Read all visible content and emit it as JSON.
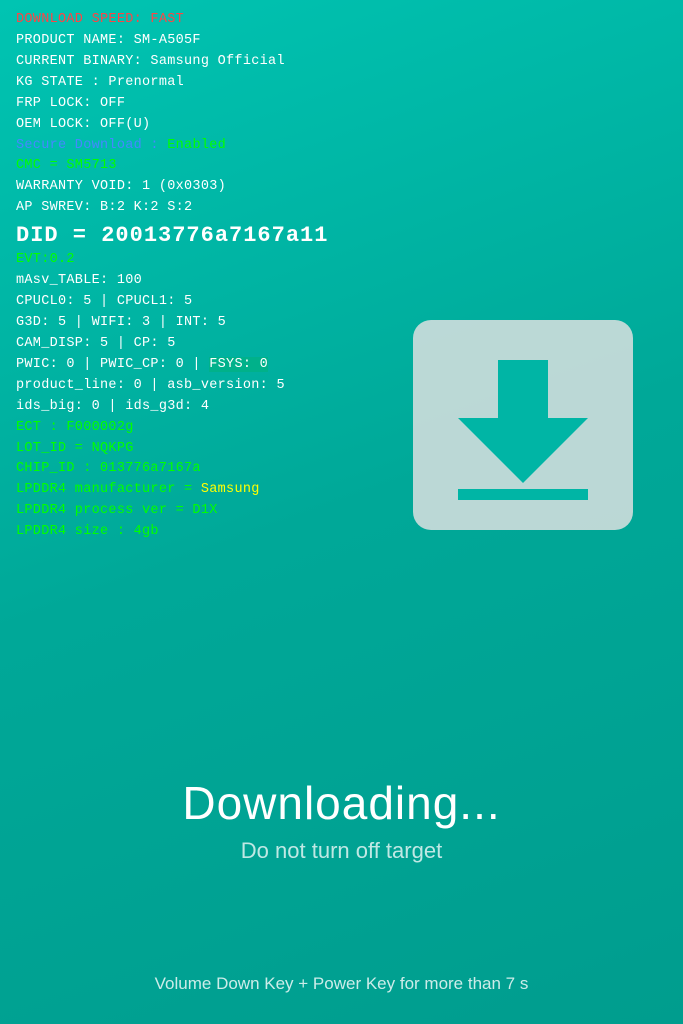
{
  "header": {
    "download_speed": "DOWNLOAD SPEED: FAST",
    "product_name": "PRODUCT NAME: SM-A505F",
    "current_binary": "CURRENT BINARY: Samsung Official",
    "kg_state": "KG STATE : Prenormal",
    "frp_lock": "FRP LOCK: OFF",
    "oem_lock": "OEM LOCK: OFF(U)",
    "secure_download_label": "Secure Download : ",
    "secure_download_value": "Enabled",
    "cmc": "CMC = SM5713",
    "warranty": "WARRANTY VOID: 1 (0x0303)",
    "ap_swrev": "AP SWREV: B:2 K:2 S:2",
    "did": "DID = 20013776a7167a11",
    "evt": "EVT:0.2",
    "masv": "mAsv_TABLE: 100",
    "cpucl0": "CPUCL0: 5 | CPUCL1: 5",
    "g3d": "G3D: 5 | WIFI: 3 | INT: 5",
    "cam_disp": "CAM_DISP: 5 | CP: 5",
    "pwic": "PWIC: 0 | PWIC_CP: 0 | FSYS: 0",
    "product_line": "product_line: 0 | asb_version: 5",
    "ids": "ids_big: 0 | ids_g3d: 4",
    "ect": "ECT : F000002g",
    "lot_id": "LOT_ID = NQKPG",
    "chip_id": "CHIP_ID : 013776a7167a",
    "lpddr4_manufacturer": "LPDDR4 manufacturer = Samsung",
    "lpddr4_process": "LPDDR4 process ver = D1X",
    "lpddr4_size": "LPDDR4 size : 4gb"
  },
  "download_icon": {
    "label": "download-arrow-icon"
  },
  "main": {
    "downloading_title": "Downloading...",
    "downloading_subtitle": "Do not turn off target"
  },
  "footer": {
    "instruction": "Volume Down Key + Power Key for more than 7 s"
  }
}
